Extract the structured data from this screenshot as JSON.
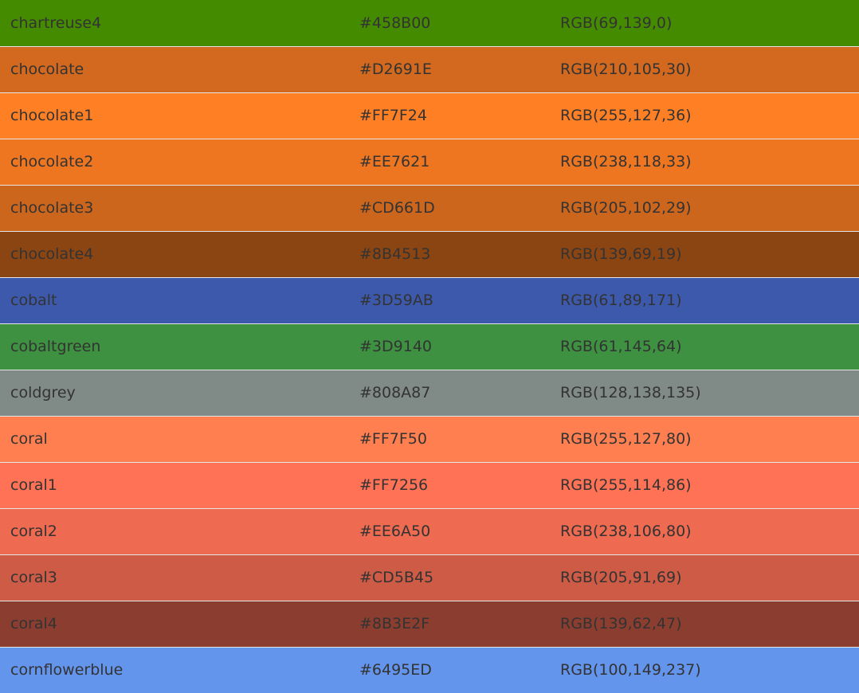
{
  "colors": [
    {
      "name": "chartreuse4",
      "hex": "#458B00",
      "rgb": "RGB(69,139,0)"
    },
    {
      "name": "chocolate",
      "hex": "#D2691E",
      "rgb": "RGB(210,105,30)"
    },
    {
      "name": "chocolate1",
      "hex": "#FF7F24",
      "rgb": "RGB(255,127,36)"
    },
    {
      "name": "chocolate2",
      "hex": "#EE7621",
      "rgb": "RGB(238,118,33)"
    },
    {
      "name": "chocolate3",
      "hex": "#CD661D",
      "rgb": "RGB(205,102,29)"
    },
    {
      "name": "chocolate4",
      "hex": "#8B4513",
      "rgb": "RGB(139,69,19)"
    },
    {
      "name": "cobalt",
      "hex": "#3D59AB",
      "rgb": "RGB(61,89,171)"
    },
    {
      "name": "cobaltgreen",
      "hex": "#3D9140",
      "rgb": "RGB(61,145,64)"
    },
    {
      "name": "coldgrey",
      "hex": "#808A87",
      "rgb": "RGB(128,138,135)"
    },
    {
      "name": "coral",
      "hex": "#FF7F50",
      "rgb": "RGB(255,127,80)"
    },
    {
      "name": "coral1",
      "hex": "#FF7256",
      "rgb": "RGB(255,114,86)"
    },
    {
      "name": "coral2",
      "hex": "#EE6A50",
      "rgb": "RGB(238,106,80)"
    },
    {
      "name": "coral3",
      "hex": "#CD5B45",
      "rgb": "RGB(205,91,69)"
    },
    {
      "name": "coral4",
      "hex": "#8B3E2F",
      "rgb": "RGB(139,62,47)"
    },
    {
      "name": "cornflowerblue",
      "hex": "#6495ED",
      "rgb": "RGB(100,149,237)"
    }
  ]
}
